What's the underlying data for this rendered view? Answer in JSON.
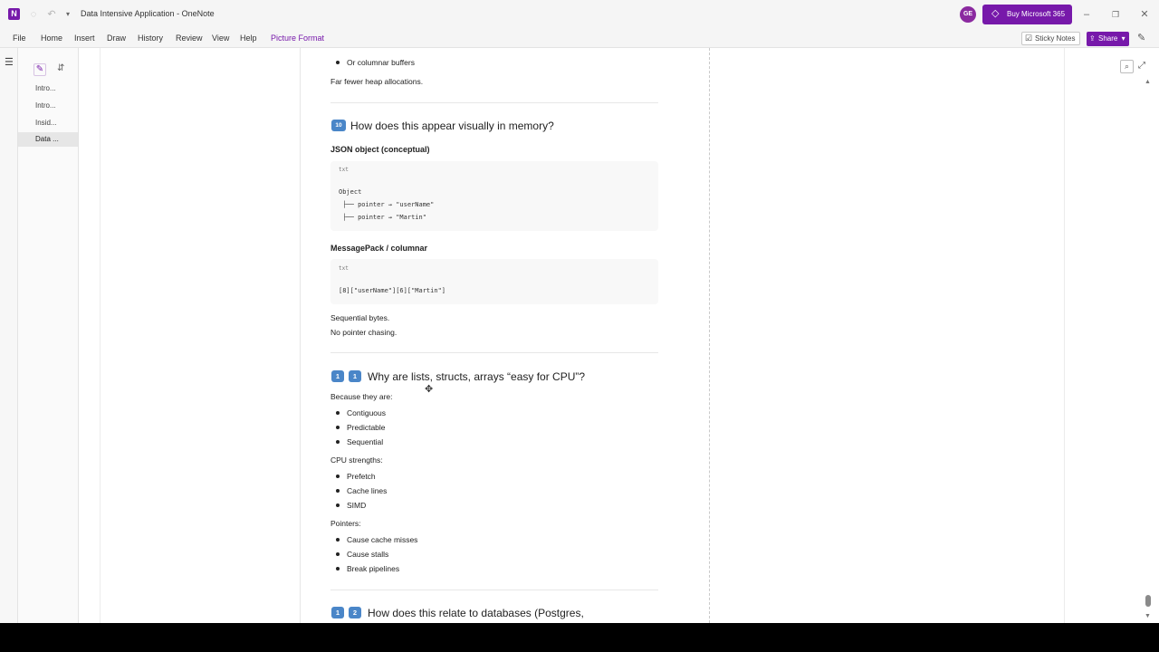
{
  "window": {
    "app_icon": "onenote-icon",
    "title": "Data Intensive Application - OneNote",
    "avatar_initials": "GE",
    "buy_label": "Buy Microsoft 365"
  },
  "menu": {
    "items": [
      "File",
      "Home",
      "Insert",
      "Draw",
      "History",
      "Review",
      "View",
      "Help",
      "Picture Format"
    ],
    "active": "Picture Format",
    "sticky_notes": "Sticky Notes",
    "share": "Share"
  },
  "pages": [
    {
      "label": "Intro..."
    },
    {
      "label": "Intro..."
    },
    {
      "label": "Insid..."
    },
    {
      "label": "Data ...",
      "selected": true
    }
  ],
  "note": {
    "prev_bullet": "Or columnar buffers",
    "prev_text": "Far fewer heap allocations.",
    "s10": {
      "emoji": "🔟",
      "title": "How does this appear visually in memory?",
      "json_heading": "JSON object (conceptual)",
      "code1_lang": "txt",
      "code1_lines": [
        "Object",
        " ├── pointer → \"userName\"",
        " ├── pointer → \"Martin\""
      ],
      "mp_heading": "MessagePack / columnar",
      "code2_lang": "txt",
      "code2_line": "[8][\"userName\"][6][\"Martin\"]",
      "text1": "Sequential bytes.",
      "text2": "No pointer chasing."
    },
    "s11": {
      "num": [
        "1",
        "1"
      ],
      "title": "Why are lists, structs, arrays “easy for CPU”?",
      "because": "Because they are:",
      "because_items": [
        "Contiguous",
        "Predictable",
        "Sequential"
      ],
      "cpu": "CPU strengths:",
      "cpu_items": [
        "Prefetch",
        "Cache lines",
        "SIMD"
      ],
      "pointers": "Pointers:",
      "pointer_items": [
        "Cause cache misses",
        "Cause stalls",
        "Break pipelines"
      ]
    },
    "s12": {
      "num": [
        "1",
        "2"
      ],
      "title": "How does this relate to databases (Postgres,"
    }
  }
}
